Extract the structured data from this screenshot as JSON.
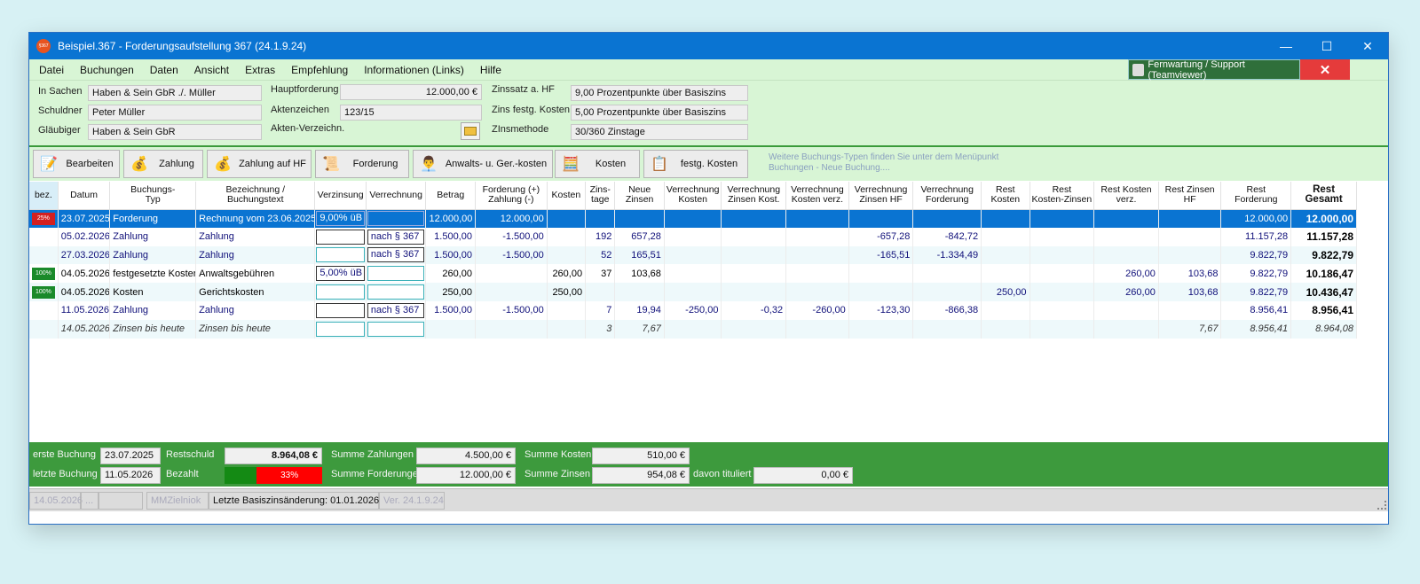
{
  "window": {
    "title": "Beispiel.367 - Forderungsaufstellung 367  (24.1.9.24)",
    "app_icon_text": "§367",
    "minimize": "—",
    "maximize": "☐",
    "close": "✕"
  },
  "menu": {
    "items": [
      "Datei",
      "Buchungen",
      "Daten",
      "Ansicht",
      "Extras",
      "Empfehlung",
      "Informationen (Links)",
      "Hilfe"
    ],
    "support_button": "Fernwartung / Support (Teamviewer)",
    "close_button": "✕"
  },
  "case": {
    "in_sachen_label": "In Sachen",
    "in_sachen": "Haben & Sein GbR ./. Müller",
    "schuldner_label": "Schuldner",
    "schuldner": "Peter Müller",
    "glaeubiger_label": "Gläubiger",
    "glaeubiger": "Haben & Sein GbR",
    "hauptforderung_label": "Hauptforderung",
    "hauptforderung": "12.000,00 €",
    "aktenzeichen_label": "Aktenzeichen",
    "aktenzeichen": "123/15",
    "akten_verzeichn_label": "Akten-Verzeichn.",
    "zinssatz_hf_label": "Zinssatz a. HF",
    "zinssatz_hf": "9,00 Prozentpunkte über Basiszins",
    "zins_kosten_label": "Zins festg. Kosten",
    "zins_kosten": "5,00 Prozentpunkte über Basiszins",
    "zinsmethode_label": "ZInsmethode",
    "zinsmethode": "30/360 Zinstage"
  },
  "toolbar": {
    "buttons": [
      "Bearbeiten",
      "Zahlung",
      "Zahlung auf HF",
      "Forderung",
      "Anwalts- u. Ger.-kosten",
      "Kosten",
      "festg. Kosten"
    ],
    "hint_line1": "Weitere Buchungs-Typen finden Sie unter dem Menüpunkt",
    "hint_line2": "Buchungen - Neue Buchung...."
  },
  "table": {
    "headers": [
      [
        "bez.",
        ""
      ],
      [
        "Datum",
        ""
      ],
      [
        "Buchungs-",
        "Typ"
      ],
      [
        "Bezeichnung /",
        "Buchungstext"
      ],
      [
        "Verzinsung",
        ""
      ],
      [
        "Verrechnung",
        ""
      ],
      [
        "Betrag",
        ""
      ],
      [
        "Forderung (+)",
        "Zahlung (-)"
      ],
      [
        "Kosten",
        ""
      ],
      [
        "Zins-",
        "tage"
      ],
      [
        "Neue",
        "Zinsen"
      ],
      [
        "Verrechnung",
        "Kosten"
      ],
      [
        "Verrechnung",
        "Zinsen Kost."
      ],
      [
        "Verrechnung",
        "Kosten verz."
      ],
      [
        "Verrechnung",
        "Zinsen HF"
      ],
      [
        "Verrechnung",
        "Forderung"
      ],
      [
        "Rest",
        "Kosten"
      ],
      [
        "Rest",
        "Kosten-Zinsen"
      ],
      [
        "Rest Kosten",
        "verz."
      ],
      [
        "Rest Zinsen",
        "HF"
      ],
      [
        "Rest",
        "Forderung"
      ],
      [
        "Rest",
        "Gesamt"
      ]
    ],
    "rows": [
      {
        "badge": "25%",
        "datum": "23.07.2025",
        "typ": "Forderung",
        "text": "Rechnung vom 23.06.2025",
        "verz": "9,00%  üB",
        "verr": "",
        "betrag": "12.000,00",
        "ford": "12.000,00",
        "kosten": "",
        "tage": "",
        "zinsen": "",
        "vk": "",
        "vzk": "",
        "vkv": "",
        "vzhf": "",
        "vf": "",
        "rk": "",
        "rkz": "",
        "rkv": "",
        "rzhf": "",
        "rf": "12.000,00",
        "rg": "12.000,00"
      },
      {
        "badge": "",
        "datum": "05.02.2026",
        "typ": "Zahlung",
        "text": "Zahlung",
        "verz": "",
        "verr": "nach § 367",
        "betrag": "1.500,00",
        "ford": "-1.500,00",
        "kosten": "",
        "tage": "192",
        "zinsen": "657,28",
        "vk": "",
        "vzk": "",
        "vkv": "",
        "vzhf": "-657,28",
        "vf": "-842,72",
        "rk": "",
        "rkz": "",
        "rkv": "",
        "rzhf": "",
        "rf": "11.157,28",
        "rg": "11.157,28"
      },
      {
        "badge": "",
        "datum": "27.03.2026",
        "typ": "Zahlung",
        "text": "Zahlung",
        "verz": "",
        "verr": "nach § 367",
        "betrag": "1.500,00",
        "ford": "-1.500,00",
        "kosten": "",
        "tage": "52",
        "zinsen": "165,51",
        "vk": "",
        "vzk": "",
        "vkv": "",
        "vzhf": "-165,51",
        "vf": "-1.334,49",
        "rk": "",
        "rkz": "",
        "rkv": "",
        "rzhf": "",
        "rf": "9.822,79",
        "rg": "9.822,79"
      },
      {
        "badge": "100%",
        "datum": "04.05.2026",
        "typ": "festgesetzte Kosten",
        "text": "Anwaltsgebühren",
        "verz": "5,00%  üB",
        "verr": "",
        "betrag": "260,00",
        "ford": "",
        "kosten": "260,00",
        "tage": "37",
        "zinsen": "103,68",
        "vk": "",
        "vzk": "",
        "vkv": "",
        "vzhf": "",
        "vf": "",
        "rk": "",
        "rkz": "",
        "rkv": "260,00",
        "rzhf": "103,68",
        "rf": "9.822,79",
        "rg": "10.186,47"
      },
      {
        "badge": "100%",
        "datum": "04.05.2026",
        "typ": "Kosten",
        "text": "Gerichtskosten",
        "verz": "",
        "verr": "",
        "betrag": "250,00",
        "ford": "",
        "kosten": "250,00",
        "tage": "",
        "zinsen": "",
        "vk": "",
        "vzk": "",
        "vkv": "",
        "vzhf": "",
        "vf": "",
        "rk": "250,00",
        "rkz": "",
        "rkv": "260,00",
        "rzhf": "103,68",
        "rf": "9.822,79",
        "rg": "10.436,47"
      },
      {
        "badge": "",
        "datum": "11.05.2026",
        "typ": "Zahlung",
        "text": "Zahlung",
        "verz": "",
        "verr": "nach § 367",
        "betrag": "1.500,00",
        "ford": "-1.500,00",
        "kosten": "",
        "tage": "7",
        "zinsen": "19,94",
        "vk": "-250,00",
        "vzk": "-0,32",
        "vkv": "-260,00",
        "vzhf": "-123,30",
        "vf": "-866,38",
        "rk": "",
        "rkz": "",
        "rkv": "",
        "rzhf": "",
        "rf": "8.956,41",
        "rg": "8.956,41"
      },
      {
        "badge": "",
        "datum": "14.05.2026",
        "typ": "Zinsen bis heute",
        "text": "Zinsen bis heute",
        "verz": "",
        "verr": "",
        "betrag": "",
        "ford": "",
        "kosten": "",
        "tage": "3",
        "zinsen": "7,67",
        "vk": "",
        "vzk": "",
        "vkv": "",
        "vzhf": "",
        "vf": "",
        "rk": "",
        "rkz": "",
        "rkv": "",
        "rzhf": "7,67",
        "rf": "8.956,41",
        "rg": "8.964,08"
      }
    ]
  },
  "summary": {
    "erste_buchung_label": "erste Buchung",
    "erste_buchung": "23.07.2025",
    "letzte_buchung_label": "letzte Buchung",
    "letzte_buchung": "11.05.2026",
    "restschuld_label": "Restschuld",
    "restschuld": "8.964,08 €",
    "bezahlt_label": "Bezahlt",
    "bezahlt_percent": "33%",
    "bezahlt_fraction": 0.33,
    "summe_zahlungen_label": "Summe Zahlungen",
    "summe_zahlungen": "4.500,00 €",
    "summe_forderungen_label": "Summe Forderungen",
    "summe_forderungen": "12.000,00 €",
    "summe_kosten_label": "Summe Kosten",
    "summe_kosten": "510,00 €",
    "summe_zinsen_label": "Summe Zinsen",
    "summe_zinsen": "954,08 €",
    "davon_tituliert_label": "davon tituliert",
    "davon_tituliert": "0,00 €"
  },
  "status": {
    "date": "14.05.2026",
    "dots": "...",
    "user": "MMZielniok",
    "basiszins": "Letzte Basiszinsänderung: 01.01.2026",
    "version": "Ver. 24.1.9.24"
  },
  "colors": {
    "titlebar": "#0a74d2",
    "header_bg": "#d8f5d5",
    "footer_bg": "#3d9a3d",
    "selection": "#0a74d2",
    "paid_bar_green": "#148a14",
    "paid_bar_red": "#ff0000"
  }
}
